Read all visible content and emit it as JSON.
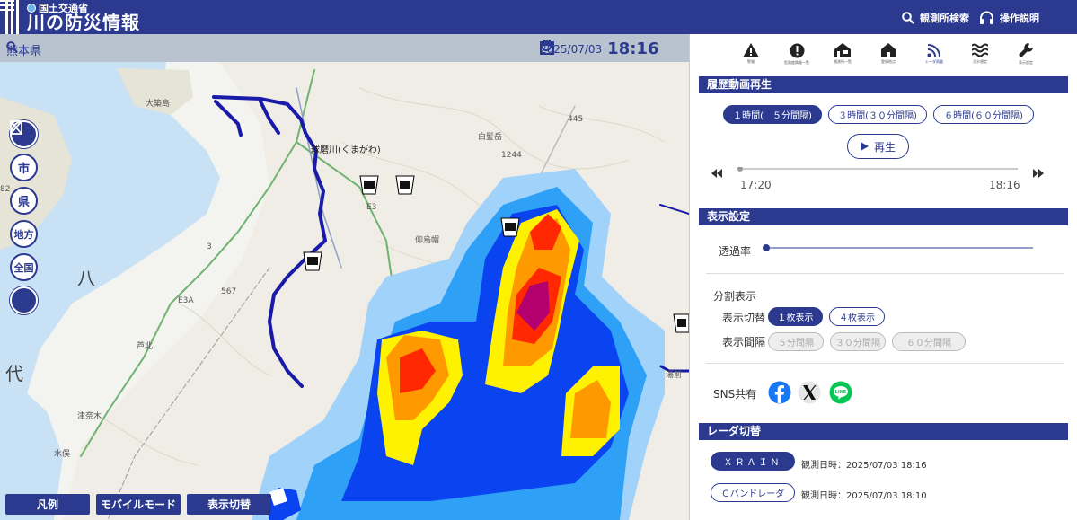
{
  "header": {
    "agency": "国土交通省",
    "title": "川の防災情報",
    "search_label": "観測所検索",
    "help_label": "操作説明"
  },
  "map": {
    "prefecture": "熊本県",
    "date": "2025/07/03",
    "time": "18:16",
    "river_label": "球磨川(くまがわ)",
    "side_buttons": [
      "市",
      "県",
      "地方",
      "全国"
    ],
    "bottom_buttons": {
      "legend": "凡例",
      "mobile": "モバイルモード",
      "display_switch": "表示切替"
    },
    "place_labels": {
      "oyano": "大築島",
      "shirahage": "白髪岳",
      "elev": "1244",
      "gyoku": "仰烏帽",
      "road445": "445",
      "e3": "E3",
      "e3a": "E3A",
      "r3": "3",
      "h567": "567",
      "ashikita": "芦北",
      "tsunagi": "津奈木",
      "minamata": "水俣",
      "yunomae": "湯前",
      "hachi": "八",
      "dai": "代",
      "num82": "82"
    }
  },
  "panel": {
    "icons": [
      {
        "name": "warning-icon",
        "label": "警報"
      },
      {
        "name": "alert-icon",
        "label": "危険度情報一覧"
      },
      {
        "name": "station-list-icon",
        "label": "観測所一覧"
      },
      {
        "name": "home-icon",
        "label": "登録地点"
      },
      {
        "name": "radar-icon",
        "label": "レーダ雨量"
      },
      {
        "name": "flood-icon",
        "label": "浸水想定"
      },
      {
        "name": "settings-icon",
        "label": "表示設定"
      }
    ],
    "history": {
      "title": "履歴動画再生",
      "interval_options": [
        "１時間(　５分間隔)",
        "３時間(３０分間隔)",
        "６時間(６０分間隔)"
      ],
      "play_label": "再生",
      "start_time": "17:20",
      "end_time": "18:16"
    },
    "display": {
      "title": "表示設定",
      "opacity_label": "透過率",
      "split_label": "分割表示",
      "switch_label": "表示切替",
      "switch_options": [
        "１枚表示",
        "４枚表示"
      ],
      "interval_label": "表示間隔",
      "interval_options": [
        "５分間隔",
        "３０分間隔",
        "６０分間隔"
      ],
      "sns_label": "SNS共有"
    },
    "radar": {
      "title": "レーダ切替",
      "xrain_label": "ＸＲＡＩＮ",
      "xrain_time": "観測日時：2025/07/03 18:16",
      "cband_label": "Ｃバンドレーダ",
      "cband_time": "観測日時：2025/07/03 18:10"
    }
  },
  "colors": {
    "brand": "#2b3a8f",
    "radar_light": "#a0d2fa",
    "radar_mid": "#2ea0f5",
    "radar_blue": "#0a44f0",
    "radar_yellow": "#fff200",
    "radar_orange": "#ff9900",
    "radar_red": "#ff2800",
    "radar_purple": "#b4006e",
    "river": "#1a1aa8"
  }
}
